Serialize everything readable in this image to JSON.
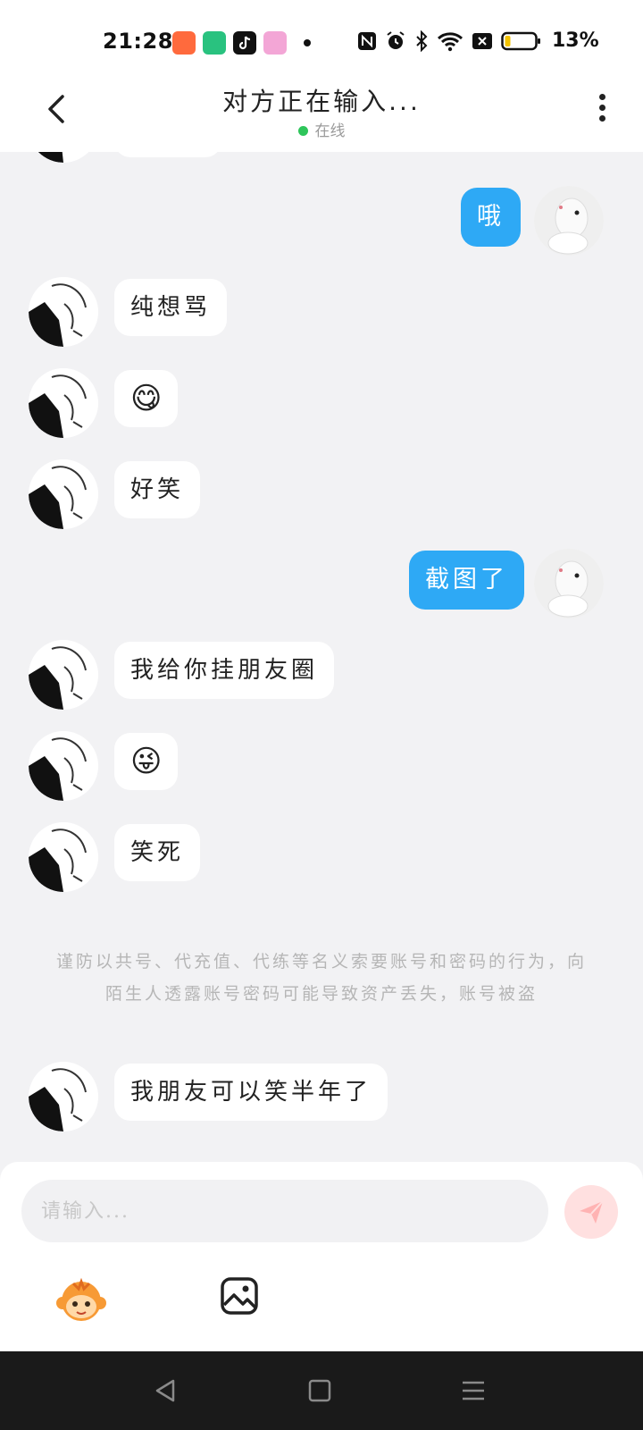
{
  "status_bar": {
    "time": "21:28",
    "battery_percent": "13%",
    "battery_level": 0.13,
    "icons": [
      "app-icon-orange",
      "app-icon-green",
      "tiktok-icon",
      "app-icon-pink",
      "nfc-icon",
      "alarm-icon",
      "bluetooth-icon",
      "wifi-icon",
      "sim-off-icon",
      "battery-icon"
    ]
  },
  "header": {
    "title": "对方正在输入...",
    "status_text": "在线",
    "status_color": "#2ec55a"
  },
  "messages": [
    {
      "side": "in",
      "text": "纯想骂"
    },
    {
      "side": "out",
      "text": "哦"
    },
    {
      "side": "in",
      "text": "😋"
    },
    {
      "side": "in",
      "text": "好笑"
    },
    {
      "side": "out",
      "text": "截图了"
    },
    {
      "side": "in",
      "text": "我给你挂朋友圈"
    },
    {
      "side": "in",
      "text": "😜"
    },
    {
      "side": "in",
      "text": "笑死"
    },
    {
      "side": "in",
      "text": "我朋友可以笑半年了"
    }
  ],
  "notice": "谨防以共号、代充值、代练等名义索要账号和密码的行为，向陌生人透露账号密码可能导致资产丢失，账号被盗",
  "input": {
    "placeholder": "请输入...",
    "value": ""
  },
  "colors": {
    "outgoing_bubble": "#2ea9f5",
    "incoming_bubble": "#ffffff",
    "background": "#f2f2f4",
    "send_button": "#ffe0e0"
  }
}
